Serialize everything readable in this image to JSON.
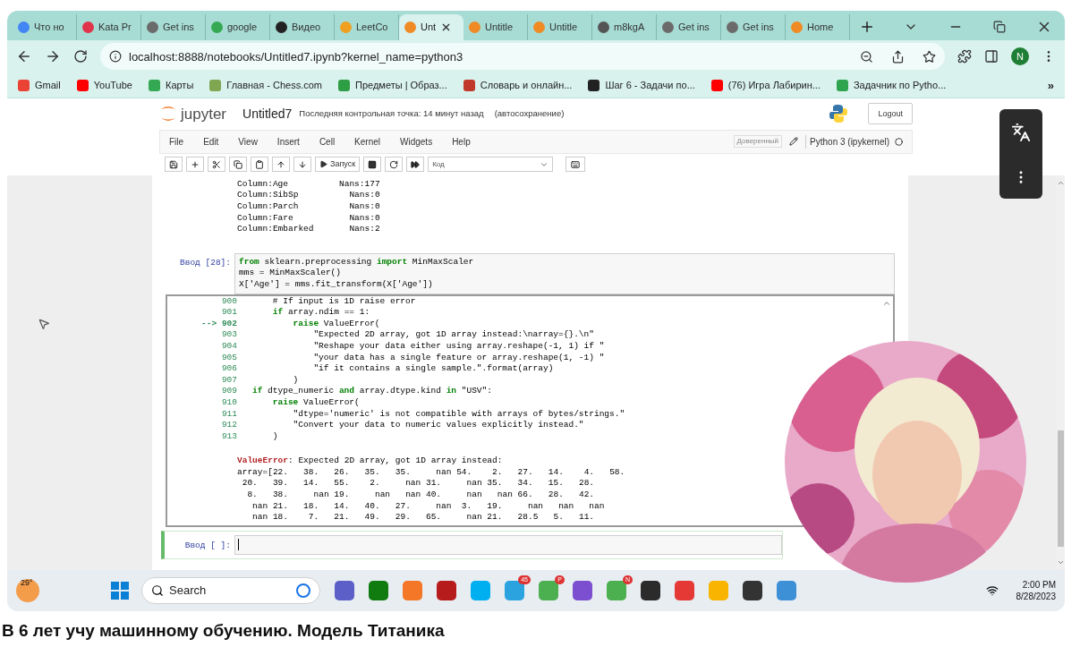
{
  "browser": {
    "tabs": [
      {
        "label": "Что но",
        "color": "#4285f4",
        "selected": false
      },
      {
        "label": "Kata Pr",
        "color": "#e0344a",
        "selected": false
      },
      {
        "label": "Get ins",
        "color": "#6b6b6b",
        "selected": false
      },
      {
        "label": "google",
        "color": "#34a853",
        "selected": false
      },
      {
        "label": "Видео",
        "color": "#222222",
        "selected": false
      },
      {
        "label": "LeetCo",
        "color": "#f0a020",
        "selected": false
      },
      {
        "label": "Unt",
        "color": "#f08a24",
        "selected": true
      },
      {
        "label": "Untitle",
        "color": "#f08a24",
        "selected": false
      },
      {
        "label": "Untitle",
        "color": "#f08a24",
        "selected": false
      },
      {
        "label": "m8kgA",
        "color": "#555555",
        "selected": false
      },
      {
        "label": "Get ins",
        "color": "#6b6b6b",
        "selected": false
      },
      {
        "label": "Get ins",
        "color": "#6b6b6b",
        "selected": false
      },
      {
        "label": "Home",
        "color": "#f08a24",
        "selected": false
      }
    ],
    "address": "localhost:8888/notebooks/Untitled7.ipynb?kernel_name=python3",
    "profile_initial": "N",
    "bookmarks": [
      {
        "label": "Gmail",
        "color": "#ea4335"
      },
      {
        "label": "YouTube",
        "color": "#ff0000"
      },
      {
        "label": "Карты",
        "color": "#34a853"
      },
      {
        "label": "Главная - Chess.com",
        "color": "#7fa650"
      },
      {
        "label": "Предметы | Образ...",
        "color": "#2e9e44"
      },
      {
        "label": "Словарь и онлайн...",
        "color": "#c0392b"
      },
      {
        "label": "Шаг 6 - Задачи по...",
        "color": "#222222"
      },
      {
        "label": "(76) Игра Лабирин...",
        "color": "#ff0000"
      },
      {
        "label": "Задачник по Pytho...",
        "color": "#2ea44f"
      }
    ],
    "bookmarks_more": "»"
  },
  "jupyter": {
    "logo": "jupyter",
    "notebook_name": "Untitled7",
    "checkpoint": "Последняя контрольная точка: 14 минут назад",
    "autosave": "(автосохранение)",
    "logout": "Logout",
    "menu": [
      "File",
      "Edit",
      "View",
      "Insert",
      "Cell",
      "Kernel",
      "Widgets",
      "Help"
    ],
    "trusted": "Доверенный",
    "kernel": "Python 3 (ipykernel)",
    "run_label": "Запуск",
    "cell_type": "Код"
  },
  "notebook": {
    "prev_output": [
      "Column:Age          Nans:177",
      "Column:SibSp          Nans:0",
      "Column:Parch          Nans:0",
      "Column:Fare           Nans:0",
      "Column:Embarked       Nans:2"
    ],
    "cell": {
      "prompt": "Ввод [28]:",
      "code": [
        "**from** sklearn.preprocessing **import** MinMaxScaler",
        "mms = MinMaxScaler()",
        "X['Age'] = mms.fit_transform(X['Age'])"
      ]
    },
    "traceback": [
      {
        "number": "900",
        "code": "    # If input is 1D raise error"
      },
      {
        "number": "901",
        "code": "    **if** array.ndim == 1:"
      },
      {
        "marker": "-->",
        "number": "902",
        "code": "        **raise** ValueError("
      },
      {
        "number": "903",
        "code": "            \"Expected 2D array, got 1D array instead:\\narray={}.\\n\""
      },
      {
        "number": "904",
        "code": "            \"Reshape your data either using array.reshape(-1, 1) if \""
      },
      {
        "number": "905",
        "code": "            \"your data has a single feature or array.reshape(1, -1) \""
      },
      {
        "number": "906",
        "code": "            \"if it contains a single sample.\".format(array)"
      },
      {
        "number": "907",
        "code": "        )"
      },
      {
        "number": "909",
        "code": "**if** dtype_numeric **and** array.dtype.kind **in** \"USV\":"
      },
      {
        "number": "910",
        "code": "    **raise** ValueError("
      },
      {
        "number": "911",
        "code": "        \"dtype='numeric' is not compatible with arrays of bytes/strings.\""
      },
      {
        "number": "912",
        "code": "        \"Convert your data to numeric values explicitly instead.\""
      },
      {
        "number": "913",
        "code": "    )"
      }
    ],
    "error": "**ValueError**: Expected 2D array, got 1D array instead:",
    "array_lines": [
      "array=[22.   38.   26.   35.   35.     nan 54.    2.   27.   14.    4.   58.",
      " 20.   39.   14.   55.    2.     nan 31.     nan 35.   34.   15.   28.",
      "  8.   38.     nan 19.     nan   nan 40.     nan   nan 66.   28.   42.",
      "   nan 21.   18.   14.   40.   27.     nan  3.   19.     nan   nan   nan",
      "   nan 18.    7.   21.   49.   29.   65.     nan 21.   28.5   5.   11."
    ],
    "new_cell": {
      "prompt": "Ввод [ ]:"
    }
  },
  "taskbar": {
    "weather": "29°",
    "search": "Search",
    "apps": [
      {
        "color": "#5b5fc7"
      },
      {
        "color": "#107c10"
      },
      {
        "color": "#f37726"
      },
      {
        "color": "#b71c1c"
      },
      {
        "color": "#00aff0"
      },
      {
        "color": "#2aa3df",
        "badge": "45"
      },
      {
        "color": "#4caf50",
        "badge": "P"
      },
      {
        "color": "#7b4fcf"
      },
      {
        "color": "#4caf50",
        "badge": "N"
      },
      {
        "color": "#2b2b2b"
      },
      {
        "color": "#e53935"
      },
      {
        "color": "#f9b400"
      },
      {
        "color": "#333333"
      },
      {
        "color": "#3d8fd6"
      }
    ],
    "time": "2:00 PM",
    "date": "8/28/2023"
  },
  "video_title": "В 6 лет учу машинному обучению. Модель Титаника"
}
